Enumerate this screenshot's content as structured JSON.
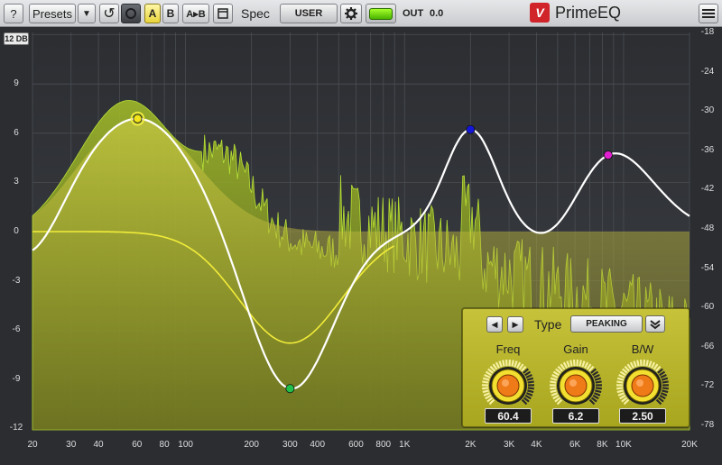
{
  "toolbar": {
    "help_label": "?",
    "presets_label": "Presets",
    "presets_drop": "▼",
    "undo_glyph": "↺",
    "a_label": "A",
    "b_label": "B",
    "ab_copy_label": "A▸B",
    "spec_label": "Spec",
    "spec_value": "USER",
    "out_label": "OUT",
    "out_value": "0.0"
  },
  "brand": {
    "logo": "V",
    "name": "PrimeEQ"
  },
  "graph": {
    "range_badge": "12 DB",
    "left_ticks": [
      "9",
      "6",
      "3",
      "0",
      "-3",
      "-6",
      "-9",
      "-12"
    ],
    "right_ticks": [
      "-18",
      "-24",
      "-30",
      "-36",
      "-42",
      "-48",
      "-54",
      "-60",
      "-66",
      "-72",
      "-78"
    ],
    "freq_ticks": [
      "20",
      "30",
      "40",
      "60",
      "80",
      "100",
      "200",
      "300",
      "400",
      "600",
      "800",
      "1K",
      "2K",
      "3K",
      "4K",
      "6K",
      "8K",
      "10K",
      "20K"
    ],
    "colors": {
      "band1": "#f3e51a",
      "band2": "#22c04a",
      "band3": "#1418d6",
      "band4": "#e020d0",
      "spectrum": "#a7c72a",
      "eq_curve": "#ffffff"
    }
  },
  "bands": [
    {
      "freq_hz": 60.4,
      "gain_db": 6.2
    },
    {
      "freq_hz": 300,
      "gain_db": -5.9
    },
    {
      "freq_hz": 2000,
      "gain_db": 7.0
    },
    {
      "freq_hz": 8500,
      "gain_db": 5.0
    }
  ],
  "band_panel": {
    "prev_glyph": "◀",
    "next_glyph": "▶",
    "type_label": "Type",
    "type_value": "PEAKING",
    "freq_label": "Freq",
    "freq_value": "60.4",
    "gain_label": "Gain",
    "gain_value": "6.2",
    "bw_label": "B/W",
    "bw_value": "2.50"
  }
}
